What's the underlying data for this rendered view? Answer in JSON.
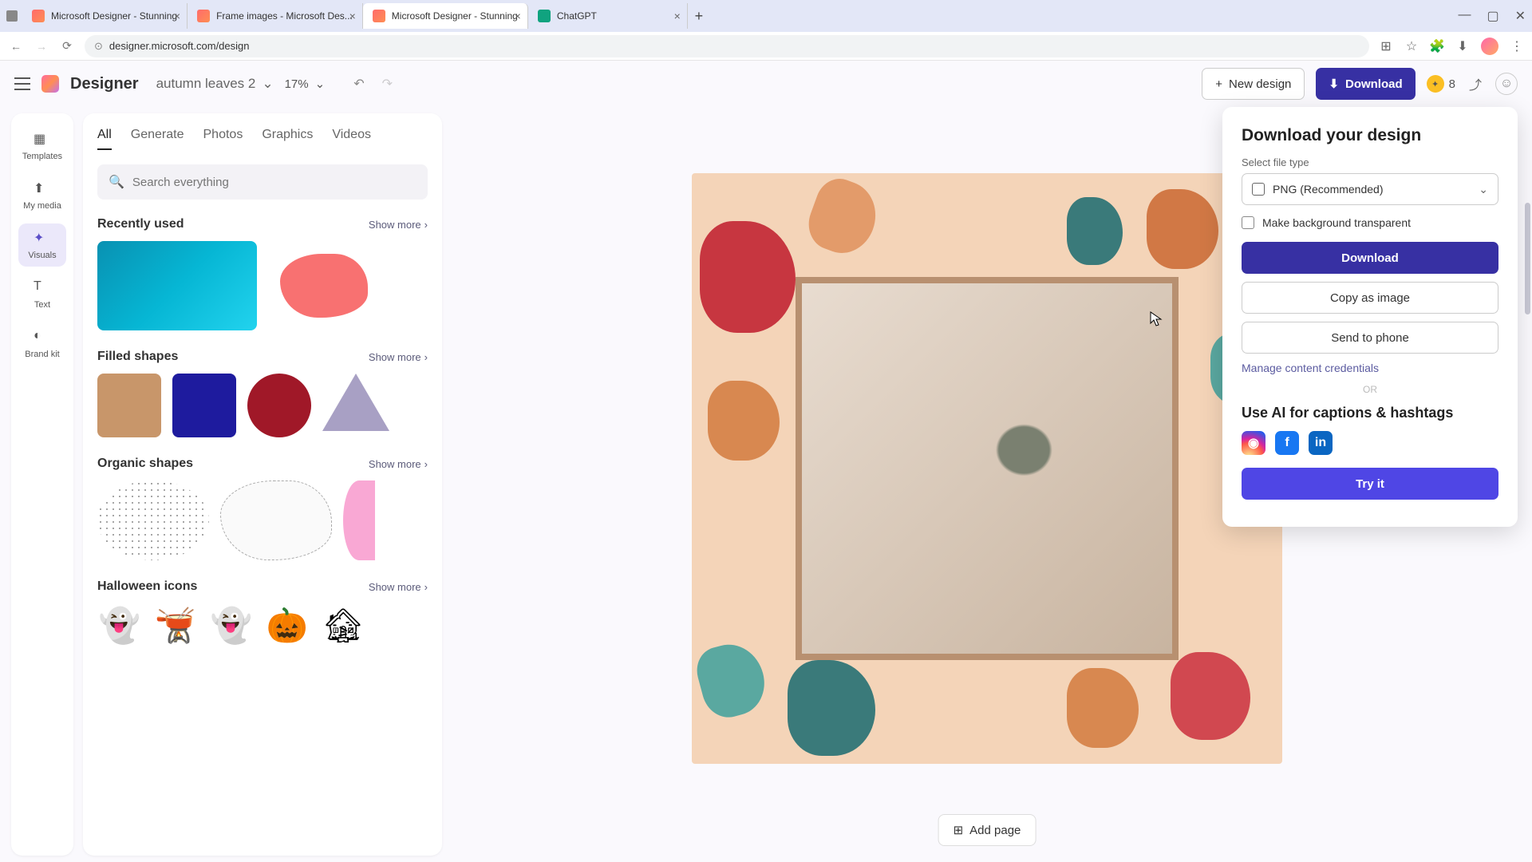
{
  "browser": {
    "tabs": [
      {
        "title": "Microsoft Designer - Stunning"
      },
      {
        "title": "Frame images - Microsoft Des..."
      },
      {
        "title": "Microsoft Designer - Stunning"
      },
      {
        "title": "ChatGPT"
      }
    ],
    "url": "designer.microsoft.com/design"
  },
  "app": {
    "brand": "Designer",
    "project": "autumn leaves 2",
    "zoom": "17%",
    "new_design": "New design",
    "download": "Download",
    "credits": "8"
  },
  "rail": {
    "templates": "Templates",
    "mymedia": "My media",
    "visuals": "Visuals",
    "text": "Text",
    "brandkit": "Brand kit"
  },
  "panel": {
    "tabs": {
      "all": "All",
      "generate": "Generate",
      "photos": "Photos",
      "graphics": "Graphics",
      "videos": "Videos"
    },
    "search_placeholder": "Search everything",
    "sections": {
      "recent": "Recently used",
      "filled": "Filled shapes",
      "organic": "Organic shapes",
      "halloween": "Halloween icons"
    },
    "show_more": "Show more"
  },
  "download_popup": {
    "title": "Download your design",
    "select_label": "Select file type",
    "file_type": "PNG (Recommended)",
    "transparent": "Make background transparent",
    "download_btn": "Download",
    "copy_btn": "Copy as image",
    "send_btn": "Send to phone",
    "manage": "Manage content credentials",
    "or": "OR",
    "ai_title": "Use AI for captions & hashtags",
    "try": "Try it"
  },
  "canvas": {
    "add_page": "Add page"
  },
  "colors": {
    "fill_square": "#c8966a",
    "fill_square2": "#1e1b9e",
    "fill_circle": "#a01828"
  }
}
